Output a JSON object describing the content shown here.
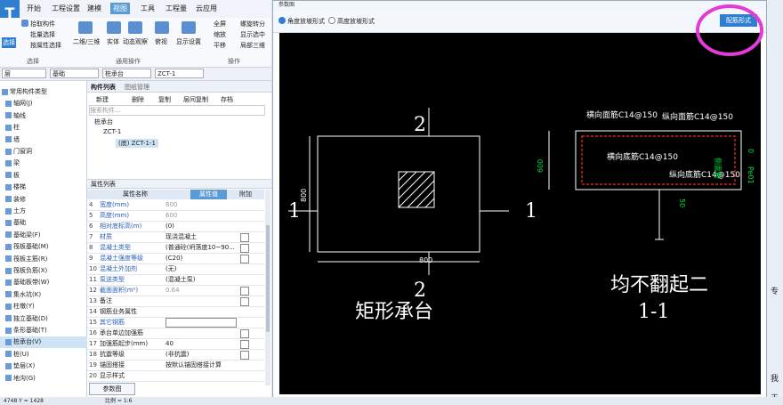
{
  "menubar": {
    "items": [
      "开始",
      "工程设置",
      "建模",
      "视图",
      "工具",
      "工程量",
      "云应用"
    ],
    "active": "视图"
  },
  "ribbon": {
    "buttons": [
      "拾取构件",
      "批量选择",
      "按属性选择",
      "选择",
      "二维/三维",
      "实体",
      "动态观察",
      "俯视",
      "显示设置",
      "全屏",
      "缩放",
      "平移",
      "螺旋转分",
      "显示选中",
      "局部三维"
    ],
    "groups": [
      "选择",
      "通用操作",
      "操作"
    ]
  },
  "toolbar2": {
    "floor": "层",
    "type": "基础",
    "subtype": "桩承台",
    "component": "ZCT-1"
  },
  "left_tree": {
    "items": [
      {
        "label": "常用构件类型",
        "sel": false
      },
      {
        "label": "轴网(J)",
        "sel": false
      },
      {
        "label": "轴线",
        "sel": false
      },
      {
        "label": "柱",
        "sel": false
      },
      {
        "label": "墙",
        "sel": false
      },
      {
        "label": "门窗洞",
        "sel": false
      },
      {
        "label": "梁",
        "sel": false
      },
      {
        "label": "板",
        "sel": false
      },
      {
        "label": "楼梯",
        "sel": false
      },
      {
        "label": "装修",
        "sel": false
      },
      {
        "label": "土方",
        "sel": false
      },
      {
        "label": "基础",
        "sel": false
      },
      {
        "label": "基础梁(F)",
        "sel": false
      },
      {
        "label": "筏板基础(M)",
        "sel": false
      },
      {
        "label": "筏板主筋(R)",
        "sel": false
      },
      {
        "label": "筏板负筋(X)",
        "sel": false
      },
      {
        "label": "基础板带(W)",
        "sel": false
      },
      {
        "label": "集水坑(K)",
        "sel": false
      },
      {
        "label": "柱墩(Y)",
        "sel": false
      },
      {
        "label": "独立基础(D)",
        "sel": false
      },
      {
        "label": "条形基础(T)",
        "sel": false
      },
      {
        "label": "桩承台(V)",
        "sel": true
      },
      {
        "label": "桩(U)",
        "sel": false
      },
      {
        "label": "垫层(X)",
        "sel": false
      },
      {
        "label": "地沟(G)",
        "sel": false
      }
    ]
  },
  "component_list": {
    "tabs": [
      "构件列表",
      "图纸管理"
    ],
    "toolbar": [
      "新建",
      "删除",
      "复制",
      "层间复制",
      "存档"
    ],
    "search_placeholder": "搜索构件...",
    "tree": [
      "桩承台",
      "ZCT-1",
      "(底) ZCT-1-1"
    ]
  },
  "properties": {
    "title": "属性列表",
    "headers": [
      "属性名称",
      "属性值",
      "附加"
    ],
    "rows": [
      {
        "num": "4",
        "name": "宽度(mm)",
        "value": "800",
        "blue": true,
        "greyval": true,
        "chk": false
      },
      {
        "num": "5",
        "name": "高度(mm)",
        "value": "600",
        "blue": true,
        "greyval": true,
        "chk": false
      },
      {
        "num": "6",
        "name": "相对底标高(m)",
        "value": "(0)",
        "blue": true,
        "greyval": false,
        "chk": false
      },
      {
        "num": "7",
        "name": "材质",
        "value": "现浇混凝土",
        "blue": true,
        "greyval": false,
        "chk": true
      },
      {
        "num": "8",
        "name": "混凝土类型",
        "value": "(普通砼(坍落度10~90...",
        "blue": true,
        "greyval": false,
        "chk": true
      },
      {
        "num": "9",
        "name": "混凝土强度等级",
        "value": "(C20)",
        "blue": true,
        "greyval": false,
        "chk": true
      },
      {
        "num": "10",
        "name": "混凝土外加剂",
        "value": "(无)",
        "blue": true,
        "greyval": false,
        "chk": false
      },
      {
        "num": "11",
        "name": "泵送类型",
        "value": "(混凝土泵)",
        "blue": true,
        "greyval": false,
        "chk": false
      },
      {
        "num": "12",
        "name": "截面面积(m²)",
        "value": "0.64",
        "blue": true,
        "greyval": true,
        "chk": true
      },
      {
        "num": "13",
        "name": "备注",
        "value": "",
        "blue": false,
        "greyval": false,
        "chk": true
      },
      {
        "num": "14",
        "name": "钢筋业务属性",
        "value": "",
        "blue": false,
        "greyval": false,
        "chk": false
      },
      {
        "num": "15",
        "name": "其它钢筋",
        "value": "",
        "blue": true,
        "greyval": false,
        "chk": false
      },
      {
        "num": "16",
        "name": "承台单边加强筋",
        "value": "",
        "blue": false,
        "greyval": false,
        "chk": true
      },
      {
        "num": "17",
        "name": "加强筋起步(mm)",
        "value": "40",
        "blue": false,
        "greyval": false,
        "chk": true
      },
      {
        "num": "18",
        "name": "抗震等级",
        "value": "(非抗震)",
        "blue": false,
        "greyval": false,
        "chk": true
      },
      {
        "num": "19",
        "name": "锚固搭接",
        "value": "按默认锚固搭接计算",
        "blue": false,
        "greyval": false,
        "chk": false
      },
      {
        "num": "20",
        "name": "显示样式",
        "value": "",
        "blue": false,
        "greyval": false,
        "chk": false
      }
    ],
    "button": "参数图"
  },
  "dialog": {
    "title": "参数图",
    "radio1": "角度放坡形式",
    "radio2": "高度放坡形式",
    "config_button": "配筋形式"
  },
  "drawing": {
    "plan": {
      "label_top": "2",
      "label_bottom": "2",
      "label_left": "1",
      "label_right": "1",
      "dim_width": "800",
      "dim_height": "800",
      "caption": "矩形承台"
    },
    "section": {
      "top_h": "横向面筋C14@150",
      "top_v": "纵向面筋C14@150",
      "bot_h": "横向底筋C14@150",
      "bot_v": "纵向底筋C14@150",
      "side": "侧面筋",
      "side_val": "0",
      "dim_height": "600",
      "dim_right": "Pe01",
      "dim_small": "50",
      "caption1": "均不翻起二",
      "caption2": "1-1"
    }
  },
  "rightstrip": {
    "t1": "专",
    "t2": "我",
    "t3": "天"
  },
  "status": {
    "coord": "4748 Y = 1428",
    "scale": "比例 = 1:6"
  },
  "colors": {
    "accent": "#2f7fd1",
    "highlight_circle": "#e23bd8",
    "rebar": "#ff2a2a",
    "rebar_text": "#00e040"
  }
}
